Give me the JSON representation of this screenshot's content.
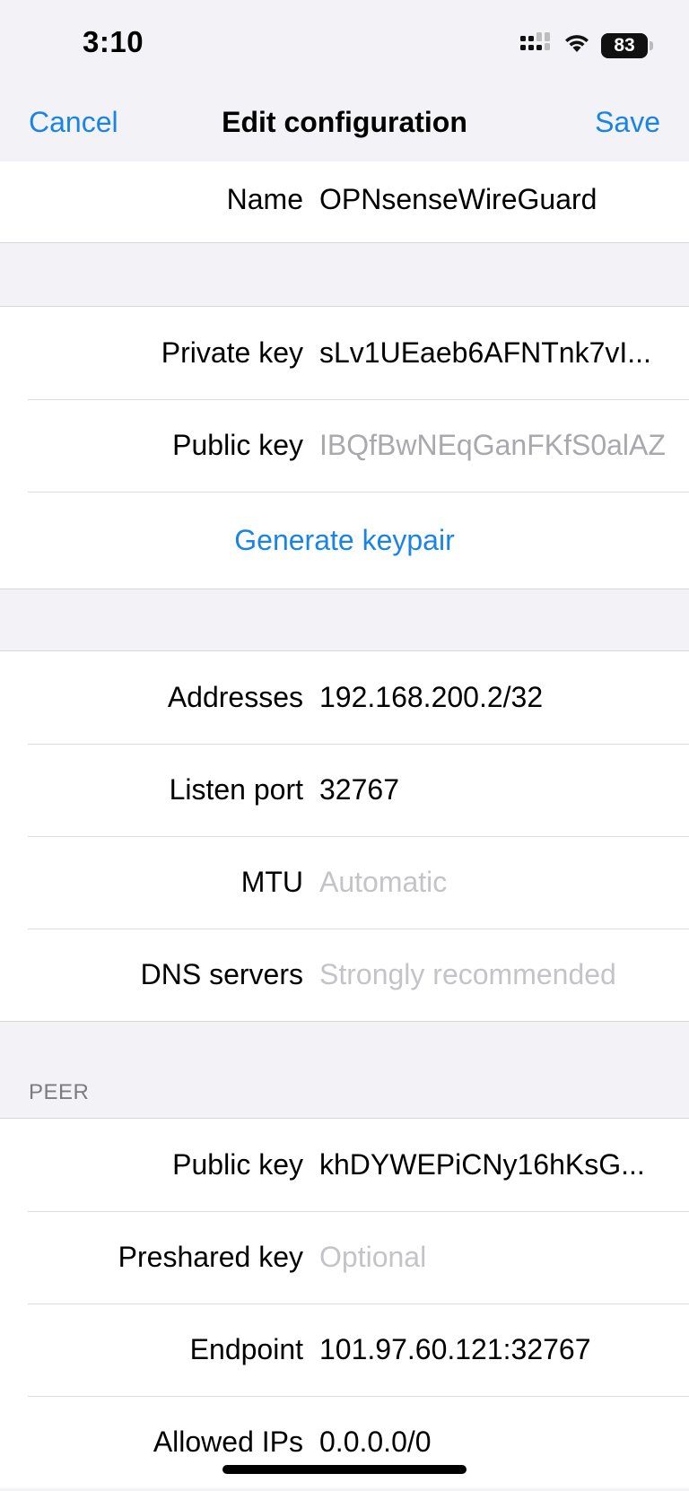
{
  "status_bar": {
    "time": "3:10",
    "battery": "83",
    "icons": [
      "cellular-signal-icon",
      "wifi-icon",
      "battery-icon"
    ]
  },
  "nav": {
    "cancel": "Cancel",
    "title": "Edit configuration",
    "save": "Save"
  },
  "name_section": {
    "name_label": "Name",
    "name_value": "OPNsenseWireGuard"
  },
  "keys_section": {
    "private_key_label": "Private key",
    "private_key_value": "sLv1UEaeb6AFNTnk7vI...",
    "public_key_label": "Public key",
    "public_key_value": "IBQfBwNEqGanFKfS0alAZ",
    "generate_label": "Generate keypair"
  },
  "interface_section": {
    "addresses_label": "Addresses",
    "addresses_value": "192.168.200.2/32",
    "listen_port_label": "Listen port",
    "listen_port_value": "32767",
    "mtu_label": "MTU",
    "mtu_placeholder": "Automatic",
    "dns_label": "DNS servers",
    "dns_placeholder": "Strongly recommended"
  },
  "peer_section": {
    "header": "PEER",
    "public_key_label": "Public key",
    "public_key_value": "khDYWEPiCNy16hKsG...",
    "preshared_label": "Preshared key",
    "preshared_placeholder": "Optional",
    "endpoint_label": "Endpoint",
    "endpoint_value": "101.97.60.121:32767",
    "allowed_ips_label": "Allowed IPs",
    "allowed_ips_value": "0.0.0.0/0"
  },
  "colors": {
    "accent": "#1a84e6",
    "grouped_background": "#f2f2f7",
    "placeholder": "#c4c4c8"
  }
}
